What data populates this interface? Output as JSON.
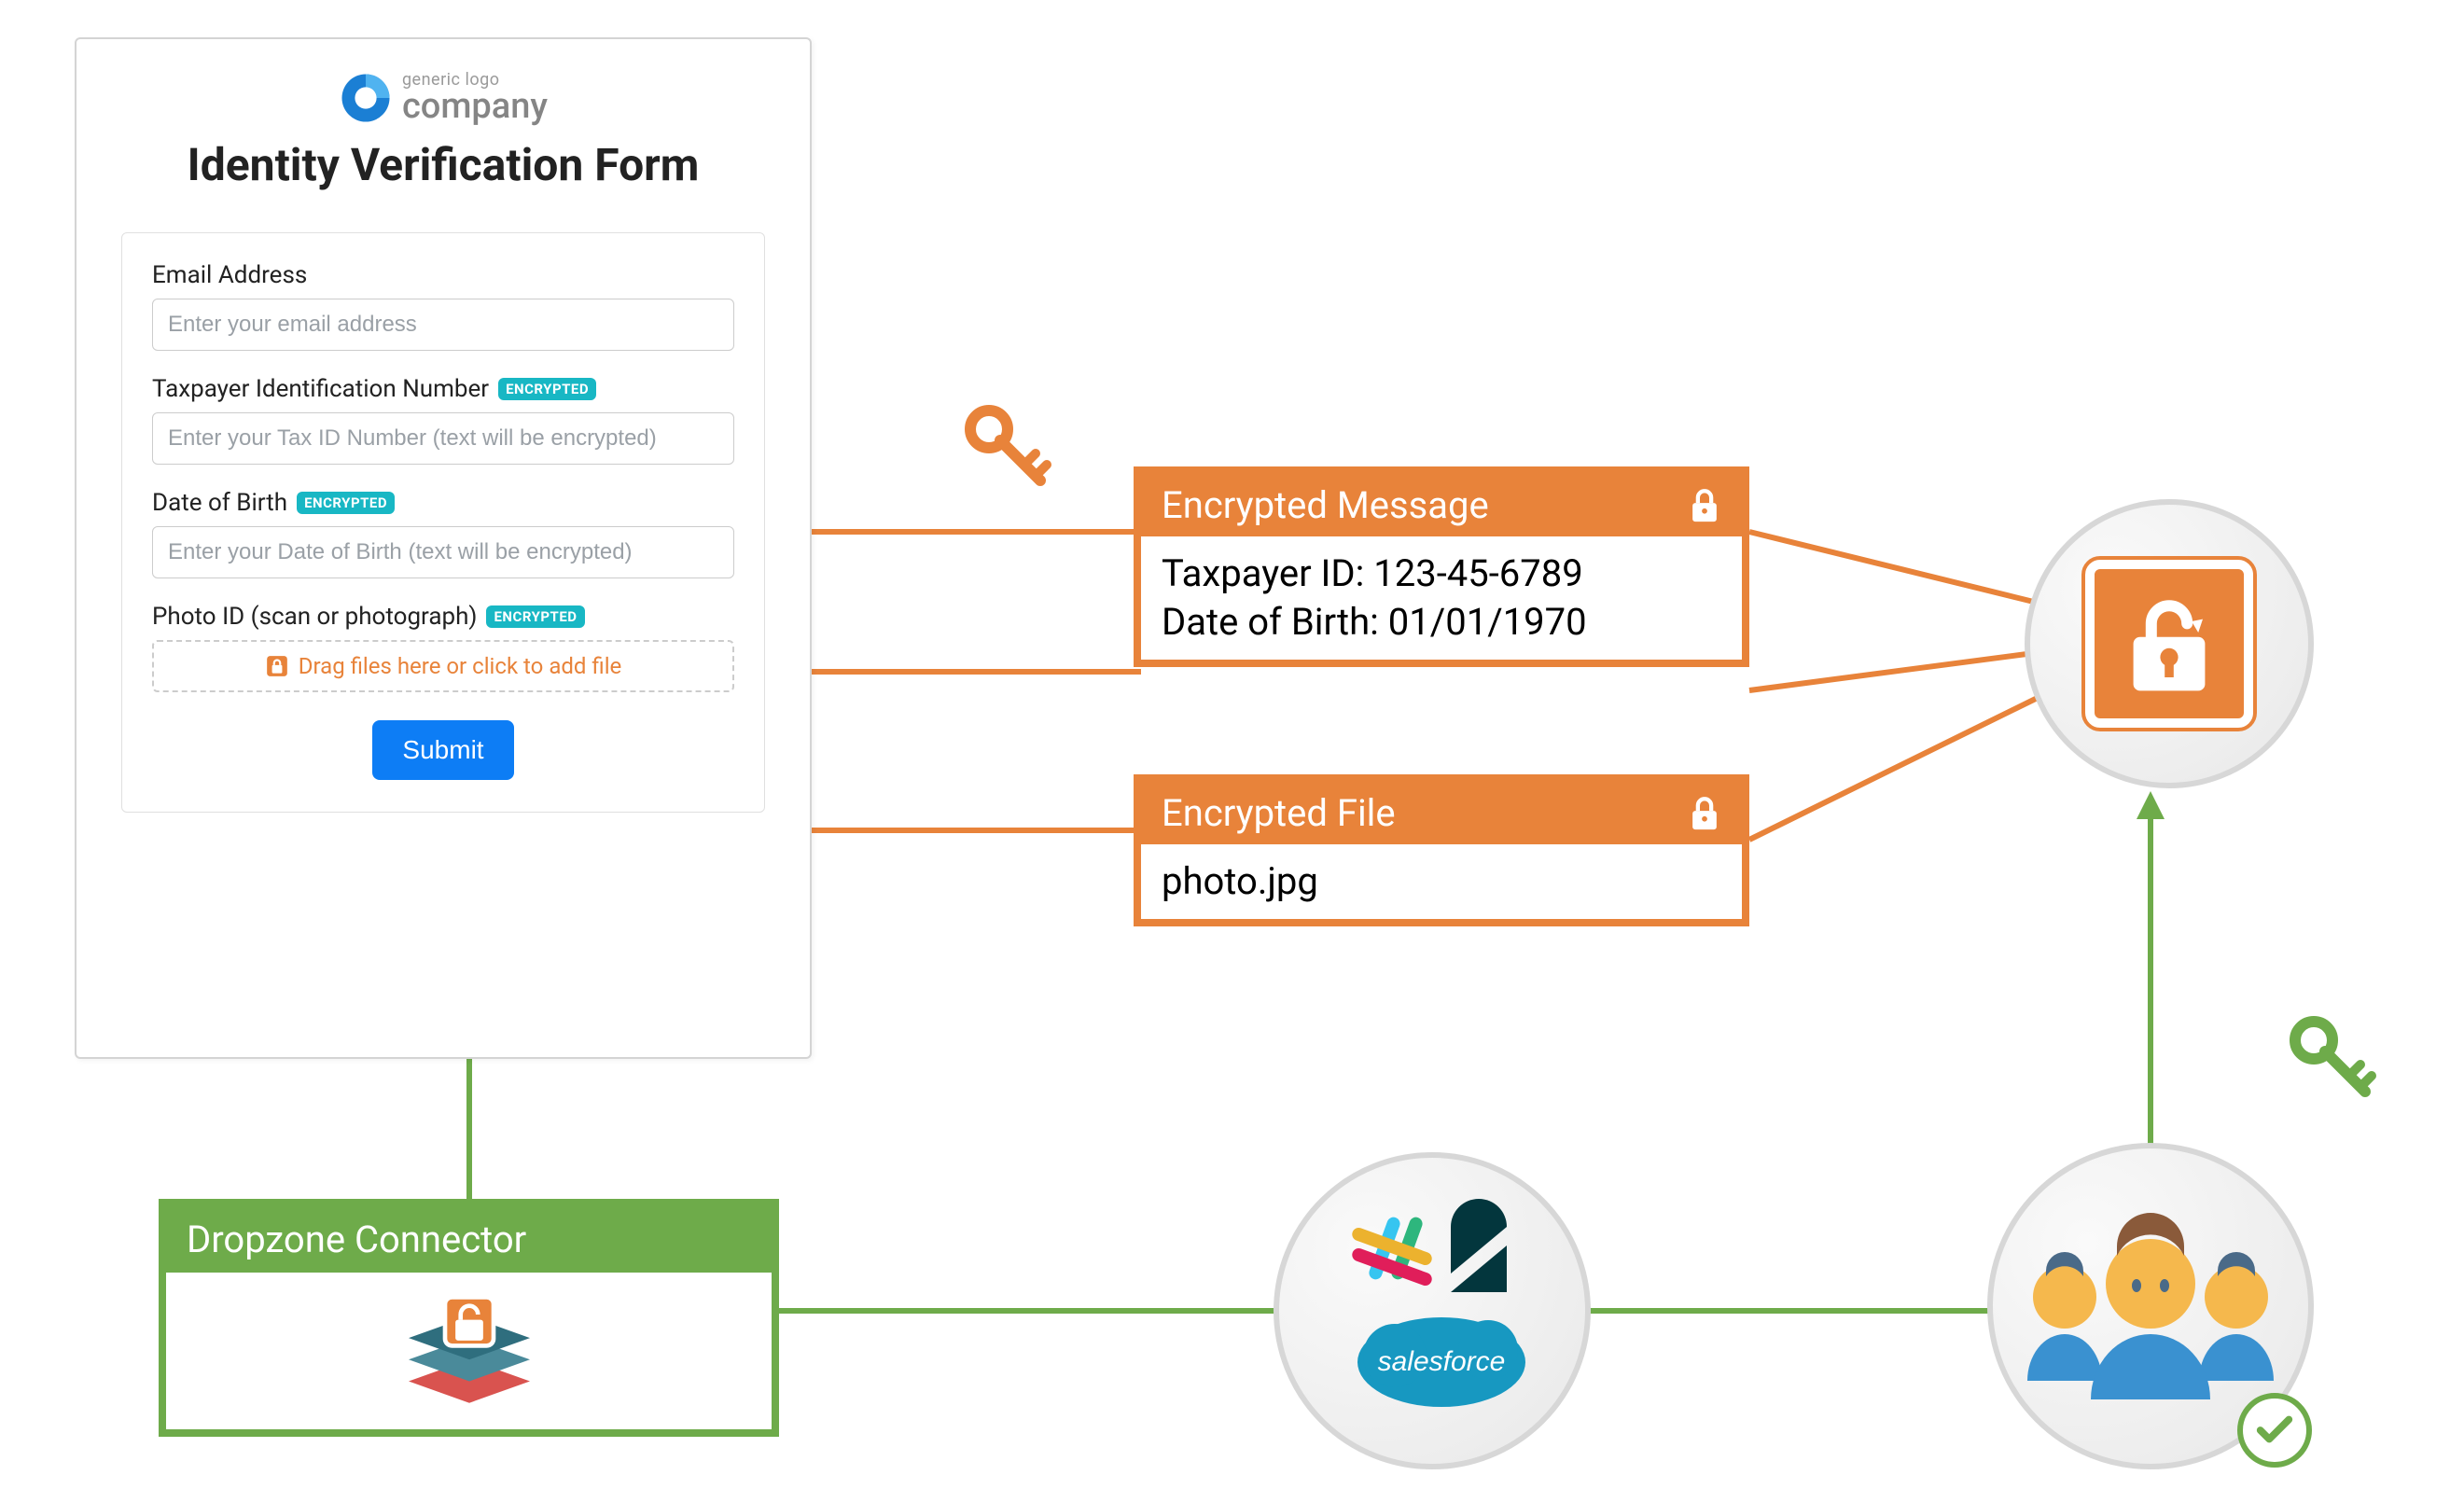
{
  "form": {
    "logo_top": "generic logo",
    "logo_bottom": "company",
    "title": "Identity Verification Form",
    "email_label": "Email Address",
    "email_placeholder": "Enter your email address",
    "tin_label": "Taxpayer Identification Number",
    "tin_placeholder": "Enter your Tax ID Number (text will be encrypted)",
    "dob_label": "Date of Birth",
    "dob_placeholder": "Enter your Date of Birth (text will be encrypted)",
    "photo_label": "Photo ID (scan or photograph)",
    "dropzone_text": "Drag files here or click to add file",
    "encrypted_badge": "ENCRYPTED",
    "submit_label": "Submit"
  },
  "connector": {
    "title": "Dropzone Connector"
  },
  "enc_message": {
    "title": "Encrypted Message",
    "line1": "Taxpayer ID: 123-45-6789",
    "line2": "Date of Birth: 01/01/1970"
  },
  "enc_file": {
    "title": "Encrypted File",
    "filename": "photo.jpg"
  },
  "services": {
    "salesforce": "salesforce"
  }
}
